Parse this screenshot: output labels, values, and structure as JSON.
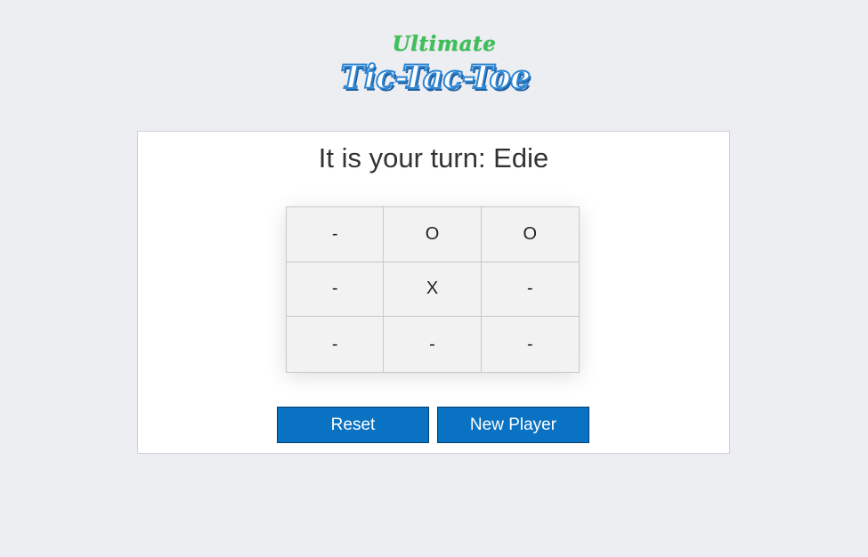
{
  "logo": {
    "top_text": "Ultimate",
    "bottom_text": "Tic-Tac-Toe"
  },
  "status": {
    "text": "It is your turn: Edie"
  },
  "board": {
    "cells": [
      "-",
      "O",
      "O",
      "-",
      "X",
      "-",
      "-",
      "-",
      "-"
    ]
  },
  "buttons": {
    "reset_label": "Reset",
    "new_player_label": "New Player"
  },
  "colors": {
    "background": "#edeef1",
    "button": "#0a72c2",
    "logo_green": "#3fbf5a",
    "logo_blue": "#2f86d2"
  }
}
